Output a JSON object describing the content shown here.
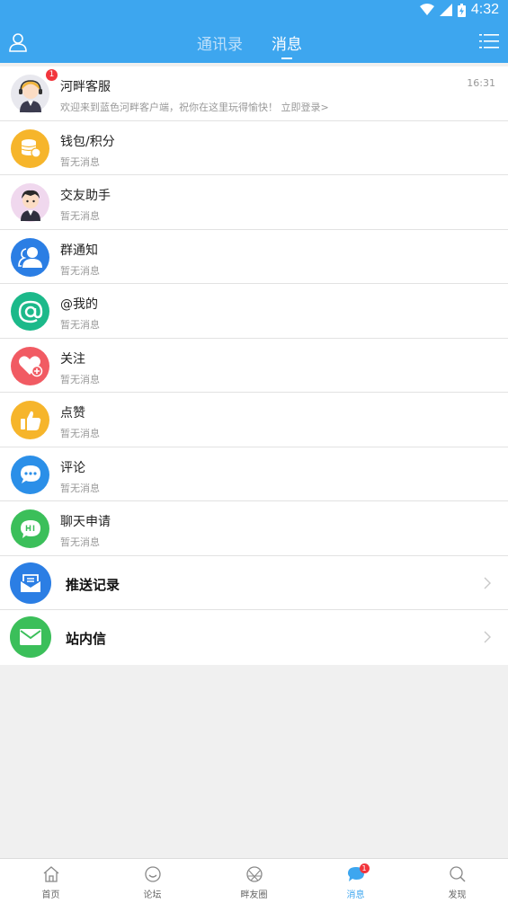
{
  "status": {
    "time": "4:32"
  },
  "header": {
    "tabs": [
      {
        "label": "通讯录",
        "active": false
      },
      {
        "label": "消息",
        "active": true
      }
    ]
  },
  "messages": [
    {
      "title": "河畔客服",
      "subtitle": "欢迎来到蓝色河畔客户端，祝你在这里玩得愉快！ 立即登录>",
      "time": "16:31",
      "badge": "1",
      "icon": "customer-service-avatar",
      "color": "#f5d08a"
    },
    {
      "title": "钱包/积分",
      "subtitle": "暂无消息",
      "icon": "wallet-icon",
      "color": "#f6b52b"
    },
    {
      "title": "交友助手",
      "subtitle": "暂无消息",
      "icon": "friend-assistant-avatar",
      "color": "#f0d8ee"
    },
    {
      "title": "群通知",
      "subtitle": "暂无消息",
      "icon": "group-icon",
      "color": "#2b7ee4"
    },
    {
      "title": "@我的",
      "subtitle": "暂无消息",
      "icon": "at-icon",
      "color": "#1cb98a"
    },
    {
      "title": "关注",
      "subtitle": "暂无消息",
      "icon": "heart-plus-icon",
      "color": "#f15b63"
    },
    {
      "title": "点赞",
      "subtitle": "暂无消息",
      "icon": "thumbs-up-icon",
      "color": "#f6b52b"
    },
    {
      "title": "评论",
      "subtitle": "暂无消息",
      "icon": "comment-icon",
      "color": "#2b8fe8"
    },
    {
      "title": "聊天申请",
      "subtitle": "暂无消息",
      "icon": "chat-request-icon",
      "color": "#3bbf5a"
    }
  ],
  "links": [
    {
      "title": "推送记录",
      "icon": "push-record-icon",
      "color": "#2b7ee4"
    },
    {
      "title": "站内信",
      "icon": "mail-icon",
      "color": "#3bbf5a"
    }
  ],
  "bottom_nav": [
    {
      "label": "首页",
      "icon": "home-icon",
      "active": false
    },
    {
      "label": "论坛",
      "icon": "forum-icon",
      "active": false
    },
    {
      "label": "畔友圈",
      "icon": "circle-icon",
      "active": false
    },
    {
      "label": "消息",
      "icon": "message-icon",
      "active": true,
      "badge": "1"
    },
    {
      "label": "发现",
      "icon": "discover-icon",
      "active": false
    }
  ],
  "colors": {
    "accent": "#3da6ef",
    "badge": "#f2353c"
  }
}
